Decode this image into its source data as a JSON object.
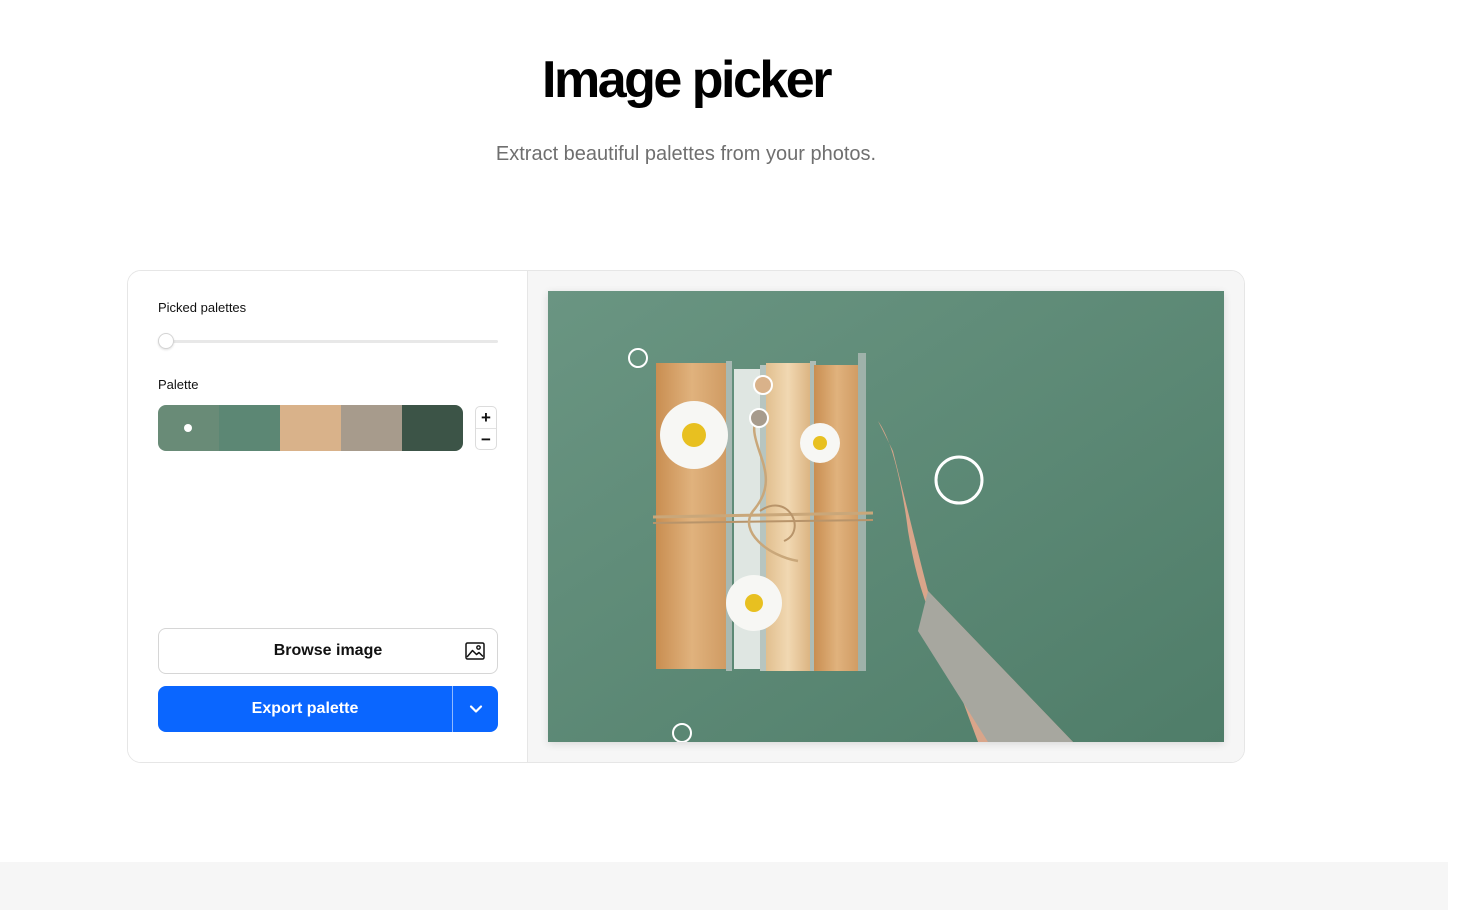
{
  "header": {
    "title": "Image picker",
    "subtitle": "Extract beautiful palettes from your photos."
  },
  "sidebar": {
    "picked_palettes_label": "Picked palettes",
    "picked_palettes_value": 0,
    "palette_label": "Palette",
    "palette": [
      {
        "color": "#698b77",
        "selected": true
      },
      {
        "color": "#5c8774",
        "selected": false
      },
      {
        "color": "#d9b28a",
        "selected": false
      },
      {
        "color": "#a79b8c",
        "selected": false
      },
      {
        "color": "#3c5447",
        "selected": false
      }
    ],
    "add_color": "+",
    "remove_color": "−",
    "browse_label": "Browse image",
    "browse_icon": "image-icon",
    "export_label": "Export palette",
    "export_menu_icon": "chevron-down-icon"
  },
  "photo": {
    "subject": "stack of books tied with twine and daisies, hand on green background",
    "background_color": "#5e8c77"
  },
  "colors": {
    "accent": "#0a66ff",
    "panel_background": "#f6f6f6",
    "border": "#e6e6e6"
  }
}
